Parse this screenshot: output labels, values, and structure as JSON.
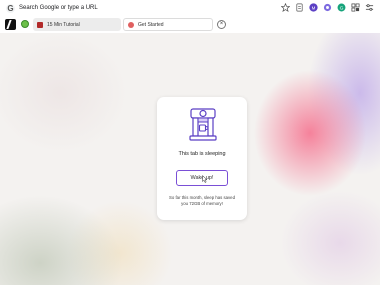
{
  "url_bar": {
    "search_icon_label": "G",
    "placeholder": "Search Google or type a URL"
  },
  "toolbar_icons": [
    "star-icon",
    "share-icon",
    "profile-icon",
    "extension-icon",
    "grammarly-icon",
    "puzzle-icon",
    "settings-icon"
  ],
  "tabs": [
    {
      "label": "15 Min Tutorial",
      "favicon": "red-square"
    },
    {
      "label": "Get Started",
      "favicon": "red-circle"
    }
  ],
  "tab_close_label": "×",
  "card": {
    "sleeping_text": "This tab is sleeping",
    "wake_button_label": "Wake up!",
    "saved_text": "So far this month, sleep has saved you 72GB of memory!"
  },
  "colors": {
    "accent": "#7a4fd6",
    "pink_glow": "#f56e8c",
    "purple_glow": "#aa8ce6"
  }
}
